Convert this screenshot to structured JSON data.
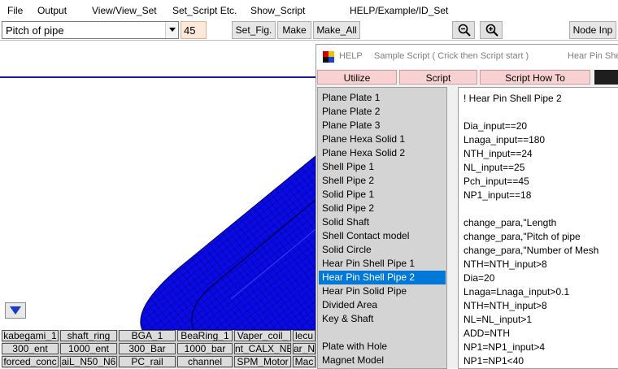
{
  "menu": {
    "file": "File",
    "output": "Output",
    "view": "View/View_Set",
    "set_script": "Set_Script Etc.",
    "show_script": "Show_Script",
    "help": "HELP/Example/ID_Set"
  },
  "toolbar": {
    "param_select": "Pitch of pipe",
    "param_value": "45",
    "set_fig": "Set_Fig.",
    "make": "Make",
    "make_all": "Make_All",
    "node_inp": "Node Inp"
  },
  "palette": [
    [
      "kabegami_1",
      "shaft_ring",
      "BGA_1",
      "BeaRing_1",
      "Vaper_coil_",
      "lecu"
    ],
    [
      "300_ent",
      "1000_ent",
      "300_Bar",
      "1000_bar",
      "nt_CALX_NE",
      "ar_N"
    ],
    [
      "forced_conc",
      "aiL_N50_N6",
      "PC_rail",
      "channel",
      "SPM_Motor",
      "Mac"
    ]
  ],
  "help_window": {
    "title": "HELP",
    "subtitle": "Sample Script ( Crick then Script start )",
    "title_right": "Hear Pin She",
    "buttons": {
      "utilize": "Utilize",
      "script": "Script",
      "how_to": "Script How To"
    },
    "list_items": [
      "Plane Plate 1",
      "Plane Plate 2",
      "Plane Plate 3",
      "Plane Hexa Solid 1",
      "Plane Hexa Solid 2",
      "Shell Pipe 1",
      "Shell Pipe 2",
      "Solid Pipe 1",
      "Solid Pipe 2",
      "Solid Shaft",
      "Shell Contact model",
      "Solid Circle",
      "Hear Pin Shell Pipe 1",
      "Hear Pin Shell Pipe 2",
      "Hear Pin Solid Pipe",
      "Divided Area",
      "Key & Shaft",
      "",
      "Plate with Hole",
      "Magnet Model"
    ],
    "selected_index": 13,
    "script_lines": [
      "!  Hear Pin Shell Pipe 2",
      "",
      "Dia_input==20",
      "Lnaga_input==180",
      "NTH_input==24",
      "NL_input==25",
      "Pch_input==45",
      "NP1_input==18",
      "",
      "change_para,\"Length",
      "change_para,\"Pitch of pipe",
      "change_para,\"Number of Mesh",
      "NTH=NTH_input>8",
      "Dia=20",
      "Lnaga=Lnaga_input>0.1",
      "NTH=NTH_input>8",
      "NL=NL_input>1",
      "ADD=NTH",
      "NP1=NP1_input>4",
      "NP1=NP1<40"
    ]
  },
  "colors": {
    "mesh_fill": "#0a0ae6",
    "mesh_line": "#000064",
    "selection": "#0078d7",
    "help_button": "#f8d2d2",
    "value_box": "#fde9d9"
  }
}
